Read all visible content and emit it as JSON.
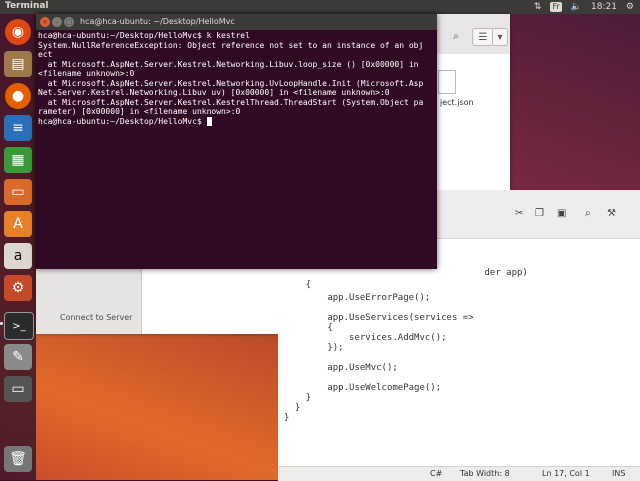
{
  "panel": {
    "app_title": "Terminal",
    "keyboard_layout": "Fr",
    "clock": "18:21"
  },
  "launcher": {
    "items": [
      {
        "name": "dash",
        "icon": "ubuntu-logo-icon",
        "color": "#dd4814"
      },
      {
        "name": "files",
        "icon": "files-icon",
        "color": "#9e7a4a"
      },
      {
        "name": "firefox",
        "icon": "firefox-icon",
        "color": "#e66000"
      },
      {
        "name": "writer",
        "icon": "writer-icon",
        "color": "#2a6fb7"
      },
      {
        "name": "calc",
        "icon": "calc-icon",
        "color": "#3a9a3a"
      },
      {
        "name": "impress",
        "icon": "impress-icon",
        "color": "#d86a2a"
      },
      {
        "name": "software-center",
        "icon": "software-center-icon",
        "color": "#e8802a"
      },
      {
        "name": "amazon",
        "icon": "amazon-icon",
        "color": "#dcd7cf"
      },
      {
        "name": "settings",
        "icon": "settings-icon",
        "color": "#c44a2a"
      },
      {
        "name": "terminal",
        "icon": "terminal-icon",
        "color": "#2b2b2b"
      },
      {
        "name": "text-editor",
        "icon": "text-editor-icon",
        "color": "#8a8a8a"
      },
      {
        "name": "disks",
        "icon": "disk-icon",
        "color": "#555555"
      },
      {
        "name": "trash",
        "icon": "trash-icon",
        "color": "#777777"
      }
    ]
  },
  "files_window": {
    "file_label": "ject.json",
    "sidebar_connect": "Connect to Server"
  },
  "editor": {
    "code_lines": [
      "                                     der app)",
      "    {",
      "        app.UseErrorPage();",
      "",
      "        app.UseServices(services =>",
      "        {",
      "            services.AddMvc();",
      "        });",
      "",
      "        app.UseMvc();",
      "",
      "        app.UseWelcomePage();",
      "    }",
      "  }",
      "}"
    ],
    "status": {
      "language": "C#",
      "tab_width": "Tab Width: 8",
      "position": "Ln 17, Col 1",
      "mode": "INS"
    }
  },
  "terminal": {
    "title": "hca@hca-ubuntu: ~/Desktop/HelloMvc",
    "lines": [
      "hca@hca-ubuntu:~/Desktop/HelloMvc$ k kestrel",
      "System.NullReferenceException: Object reference not set to an instance of an obj",
      "ect",
      "  at Microsoft.AspNet.Server.Kestrel.Networking.Libuv.loop_size () [0x00000] in",
      "<filename unknown>:0",
      "  at Microsoft.AspNet.Server.Kestrel.Networking.UvLoopHandle.Init (Microsoft.Asp",
      "Net.Server.Kestrel.Networking.Libuv uv) [0x00000] in <filename unknown>:0",
      "  at Microsoft.AspNet.Server.Kestrel.KestrelThread.ThreadStart (System.Object pa",
      "rameter) [0x00000] in <filename unknown>:0"
    ],
    "prompt": "hca@hca-ubuntu:~/Desktop/HelloMvc$ "
  },
  "colors": {
    "terminal_bg": "#300a24",
    "panel_bg": "#3c3b37",
    "close_button": "#e85d2f"
  }
}
